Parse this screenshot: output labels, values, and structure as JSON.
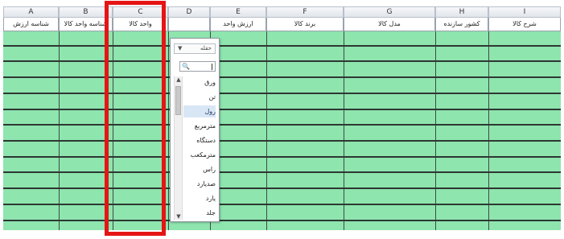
{
  "columns": [
    {
      "letter": "A",
      "header": "شناسه ارزش"
    },
    {
      "letter": "B",
      "header": "شناسه واحد کالا"
    },
    {
      "letter": "C",
      "header": "واحد کالا"
    },
    {
      "letter": "D",
      "header": ""
    },
    {
      "letter": "E",
      "header": "ارزش واحد"
    },
    {
      "letter": "F",
      "header": "برند کالا"
    },
    {
      "letter": "G",
      "header": "مدل کالا"
    },
    {
      "letter": "H",
      "header": "کشور سازنده"
    },
    {
      "letter": "I",
      "header": "شرح کالا"
    }
  ],
  "dropdown": {
    "filter_label": "حقله",
    "search_placeholder": "",
    "items": [
      "ورق",
      "تن",
      "رول",
      "مترمربع",
      "دستگاه",
      "مترمکعب",
      "راس",
      "صدیارد",
      "یارد",
      "جلد"
    ],
    "selected_index": 2
  },
  "highlight": {
    "target_column": "C",
    "color": "#e51515"
  },
  "colors": {
    "cell_fill": "#8ee5ae",
    "grid_line": "#2d3833"
  }
}
